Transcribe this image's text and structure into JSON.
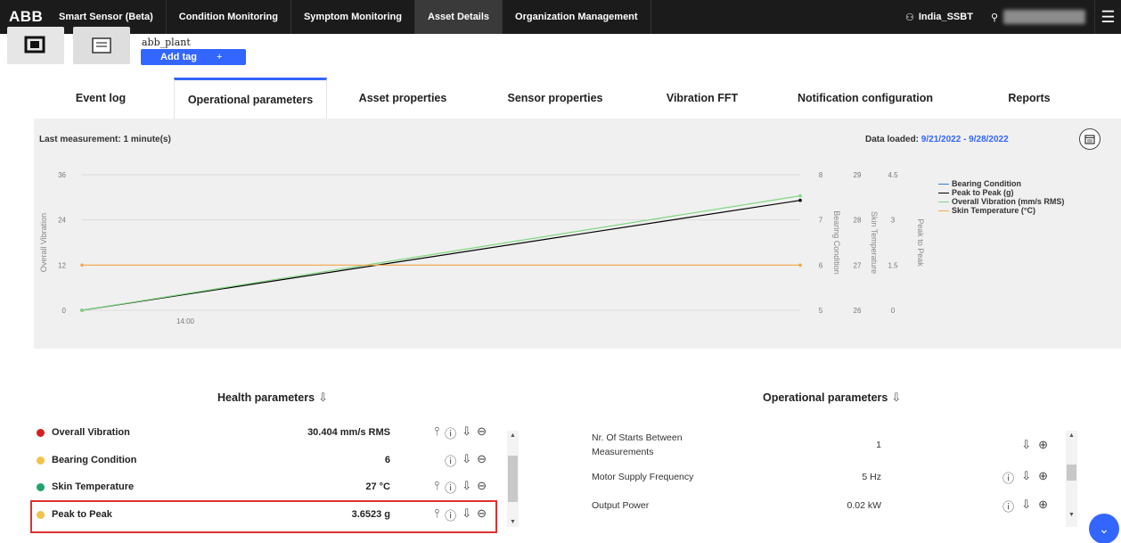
{
  "app": {
    "logo": "ABB",
    "product": "Smart Sensor (Beta)"
  },
  "nav": [
    {
      "label": "Condition Monitoring"
    },
    {
      "label": "Symptom Monitoring"
    },
    {
      "label": "Asset Details",
      "active": true
    },
    {
      "label": "Organization Management"
    }
  ],
  "org": {
    "label": "India_SSBT"
  },
  "asset": {
    "name": "abb_plant",
    "add_tag_label": "Add tag",
    "add_tag_plus": "+"
  },
  "tabs": [
    {
      "label": "Event log"
    },
    {
      "label": "Operational parameters",
      "active": true
    },
    {
      "label": "Asset properties"
    },
    {
      "label": "Sensor properties"
    },
    {
      "label": "Vibration FFT"
    },
    {
      "label": "Notification configuration"
    },
    {
      "label": "Reports"
    }
  ],
  "chart_header": {
    "last_measurement": "Last measurement: 1 minute(s)",
    "data_loaded_label": "Data loaded: ",
    "data_loaded_range": "9/21/2022 - 9/28/2022"
  },
  "chart_data": {
    "type": "line",
    "x_tick_labels": [
      "14:00"
    ],
    "left_axis": {
      "label": "Overall Vibration",
      "ticks": [
        "0",
        "12",
        "24",
        "36"
      ],
      "ylim": [
        0,
        36
      ]
    },
    "right_axes": [
      {
        "label": "Bearing Condition",
        "ticks": [
          "5",
          "6",
          "7",
          "8"
        ],
        "ylim": [
          5,
          8
        ]
      },
      {
        "label": "Skin Temperature",
        "ticks": [
          "26",
          "27",
          "28",
          "29"
        ],
        "ylim": [
          26,
          29
        ]
      },
      {
        "label": "Peak to Peak",
        "ticks": [
          "0",
          "1.5",
          "3",
          "4.5"
        ],
        "ylim": [
          0,
          4.5
        ]
      }
    ],
    "series": [
      {
        "name": "Bearing Condition",
        "color": "#2e7dd7",
        "axis": "Bearing Condition",
        "points": []
      },
      {
        "name": "Peak to Peak (g)",
        "color": "#000000",
        "axis": "Peak to Peak",
        "points": [
          [
            0,
            0
          ],
          [
            1,
            3.65
          ]
        ]
      },
      {
        "name": "Overall Vibration (mm/s RMS)",
        "color": "#7ed67e",
        "axis": "Overall Vibration",
        "points": [
          [
            0,
            0
          ],
          [
            1,
            30.4
          ]
        ]
      },
      {
        "name": "Skin Temperature (°C)",
        "color": "#f5a64a",
        "axis": "Skin Temperature",
        "points": [
          [
            0,
            27
          ],
          [
            1,
            27
          ]
        ]
      }
    ]
  },
  "health": {
    "title": "Health parameters",
    "rows": [
      {
        "name": "Overall Vibration",
        "value": "30.404 mm/s RMS",
        "color": "#d42020",
        "icons": [
          "settings-icon",
          "info-icon",
          "download-icon",
          "remove-icon"
        ]
      },
      {
        "name": "Bearing Condition",
        "value": "6",
        "color": "#f2c24a",
        "icons": [
          "info-icon",
          "download-icon",
          "remove-icon"
        ]
      },
      {
        "name": "Skin Temperature",
        "value": "27 °C",
        "color": "#1fa36b",
        "icons": [
          "settings-icon",
          "info-icon",
          "download-icon",
          "remove-icon"
        ]
      },
      {
        "name": "Peak to Peak",
        "value": "3.6523 g",
        "color": "#f2c24a",
        "icons": [
          "settings-icon",
          "info-icon",
          "download-icon",
          "remove-icon"
        ]
      }
    ]
  },
  "operational": {
    "title": "Operational parameters",
    "rows": [
      {
        "name": "Nr. Of Starts Between Measurements",
        "value": "1",
        "icons": [
          "download-icon",
          "add-icon"
        ]
      },
      {
        "name": "Motor Supply Frequency",
        "value": "5 Hz",
        "icons": [
          "info-icon",
          "download-icon",
          "add-icon"
        ]
      },
      {
        "name": "Output Power",
        "value": "0.02 kW",
        "icons": [
          "info-icon",
          "download-icon",
          "add-icon"
        ]
      }
    ]
  },
  "icons": {
    "settings": "⫯",
    "info": "ⓘ",
    "download": "⇩",
    "remove": "⊖",
    "add": "⊕",
    "menu": "☰",
    "org": "⚇",
    "user": "⚲",
    "fab": "⌄"
  }
}
